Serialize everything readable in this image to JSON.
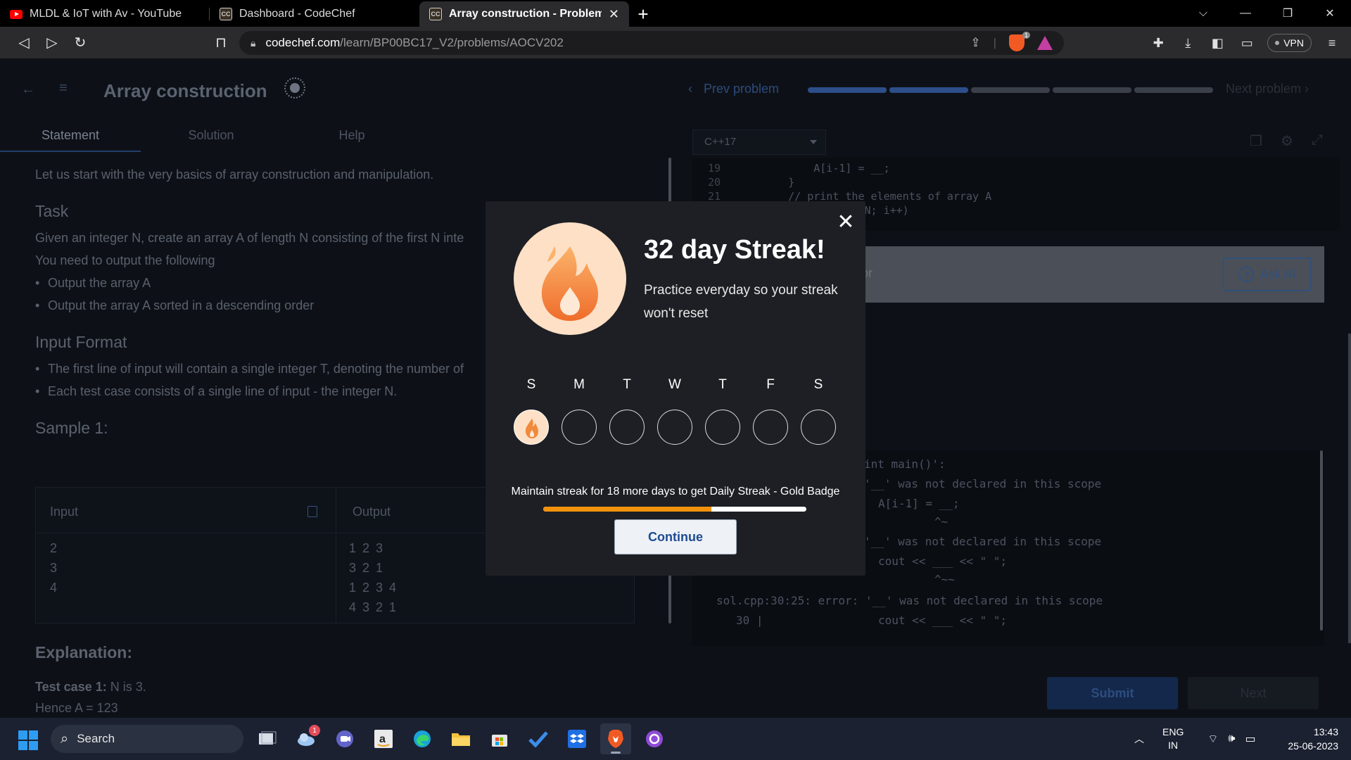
{
  "browser": {
    "tabs": [
      {
        "title": "MLDL & IoT with Av - YouTube",
        "icon": "youtube-icon",
        "active": false
      },
      {
        "title": "Dashboard - CodeChef",
        "icon": "codechef-icon",
        "active": false
      },
      {
        "title": "Array construction - Problems - C",
        "icon": "codechef-icon",
        "active": true
      }
    ],
    "favicon_text": "CC",
    "url_host": "codechef.com",
    "url_path": "/learn/BP00BC17_V2/problems/AOCV202",
    "brave_badge": "1",
    "vpn_label": "VPN"
  },
  "problem": {
    "title": "Array construction",
    "prev_label": "Prev problem",
    "next_label": "Next problem",
    "progress_segments": 5,
    "tabs": [
      "Statement",
      "Solution",
      "Help"
    ],
    "intro": "Let us start with the very basics of array construction and manipulation.",
    "task_heading": "Task",
    "task_line1": "Given an integer N, create an array A of length N consisting of the first N inte",
    "task_line2": "You need to output the following",
    "task_bullets": [
      "Output the array A",
      "Output the array A sorted in a descending order"
    ],
    "input_heading": "Input Format",
    "input_bullets": [
      "The first line of input will contain a single integer T, denoting the number of",
      "Each test case consists of a single line of input - the integer N."
    ],
    "sample_heading": "Sample 1:",
    "sample_input_label": "Input",
    "sample_output_label": "Output",
    "sample_input_lines": [
      "2",
      "3",
      "4"
    ],
    "sample_output_lines": [
      "1 2 3",
      "3 2 1",
      "1 2 3 4",
      "4 3 2 1"
    ],
    "explanation_heading": "Explanation:",
    "testcase_label": "Test case 1:",
    "testcase_text": "N is 3.",
    "hence_text": "Hence A = 123"
  },
  "editor": {
    "language": "C++17",
    "lines": [
      {
        "num": "19",
        "code": "        A[i-1] = __;"
      },
      {
        "num": "20",
        "code": "    }"
      },
      {
        "num": "21",
        "code": "    // print the elements of array A"
      },
      {
        "num": "",
        "code": "          ; i < N; i++)"
      }
    ],
    "ai_bar_text": "or",
    "ask_ai_label": "Ask AI",
    "console_lines": [
      "int main()':",
      "'__' was not declared in this scope",
      "A[i-1] = __;",
      "^~",
      "'__' was not declared in this scope",
      "cout << ___ << \" \";",
      "^~~",
      "sol.cpp:30:25: error: '__' was not declared in this scope",
      "30 |",
      "cout << ___ << \" \";"
    ],
    "submit_label": "Submit",
    "next_label": "Next"
  },
  "modal": {
    "title": "32 day Streak!",
    "subtitle": "Practice everyday so your streak won't reset",
    "days": [
      "S",
      "M",
      "T",
      "W",
      "T",
      "F",
      "S"
    ],
    "completed_days": 1,
    "maintain_text": "Maintain streak for 18 more days to get Daily Streak - Gold Badge",
    "progress_fraction": 0.64,
    "continue_label": "Continue",
    "accent_color": "#f2920c"
  },
  "taskbar": {
    "search_placeholder": "Search",
    "notification_count": "1",
    "lang_line1": "ENG",
    "lang_line2": "IN",
    "time": "13:43",
    "date": "25-06-2023"
  }
}
